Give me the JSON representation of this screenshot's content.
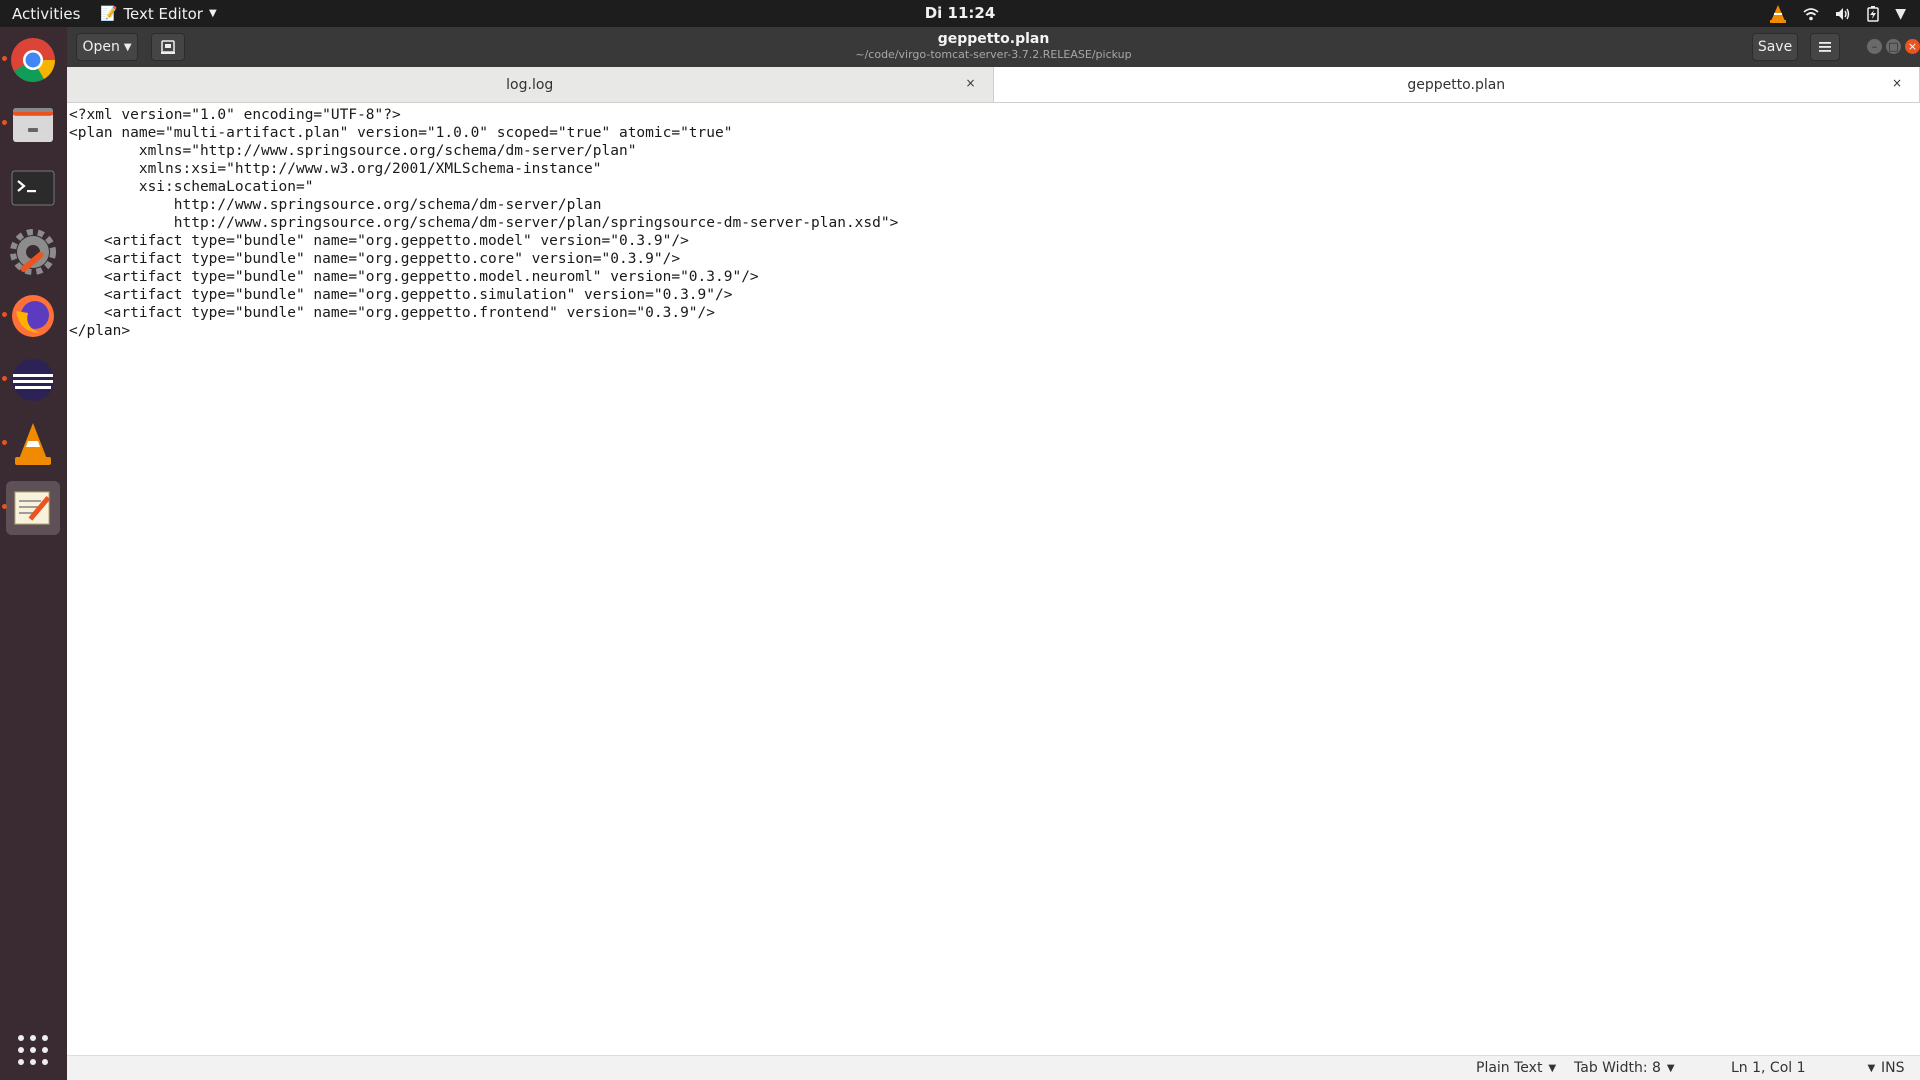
{
  "topbar": {
    "activities": "Activities",
    "app_name": "Text Editor",
    "clock": "Di 11:24"
  },
  "dock": {
    "items": [
      "chrome",
      "files",
      "terminal",
      "settings",
      "firefox",
      "eclipse",
      "vlc",
      "text-editor"
    ]
  },
  "header": {
    "open_label": "Open",
    "save_label": "Save",
    "title": "geppetto.plan",
    "subtitle": "~/code/virgo-tomcat-server-3.7.2.RELEASE/pickup"
  },
  "tabs": [
    {
      "label": "log.log",
      "active": false
    },
    {
      "label": "geppetto.plan",
      "active": true
    }
  ],
  "editor": {
    "lines": [
      "<?xml version=\"1.0\" encoding=\"UTF-8\"?>",
      "<plan name=\"multi-artifact.plan\" version=\"1.0.0\" scoped=\"true\" atomic=\"true\"",
      "        xmlns=\"http://www.springsource.org/schema/dm-server/plan\"",
      "        xmlns:xsi=\"http://www.w3.org/2001/XMLSchema-instance\"",
      "        xsi:schemaLocation=\"",
      "            http://www.springsource.org/schema/dm-server/plan",
      "            http://www.springsource.org/schema/dm-server/plan/springsource-dm-server-plan.xsd\">",
      "    <artifact type=\"bundle\" name=\"org.geppetto.model\" version=\"0.3.9\"/>",
      "    <artifact type=\"bundle\" name=\"org.geppetto.core\" version=\"0.3.9\"/>",
      "    <artifact type=\"bundle\" name=\"org.geppetto.model.neuroml\" version=\"0.3.9\"/>",
      "    <artifact type=\"bundle\" name=\"org.geppetto.simulation\" version=\"0.3.9\"/>",
      "    <artifact type=\"bundle\" name=\"org.geppetto.frontend\" version=\"0.3.9\"/>",
      "</plan>"
    ]
  },
  "statusbar": {
    "language": "Plain Text",
    "tab_width": "Tab Width: 8",
    "position": "Ln 1, Col 1",
    "mode": "INS"
  },
  "colors": {
    "accent": "#e95420",
    "dock_bg": "#3a2b33",
    "header_bg": "#393939"
  }
}
